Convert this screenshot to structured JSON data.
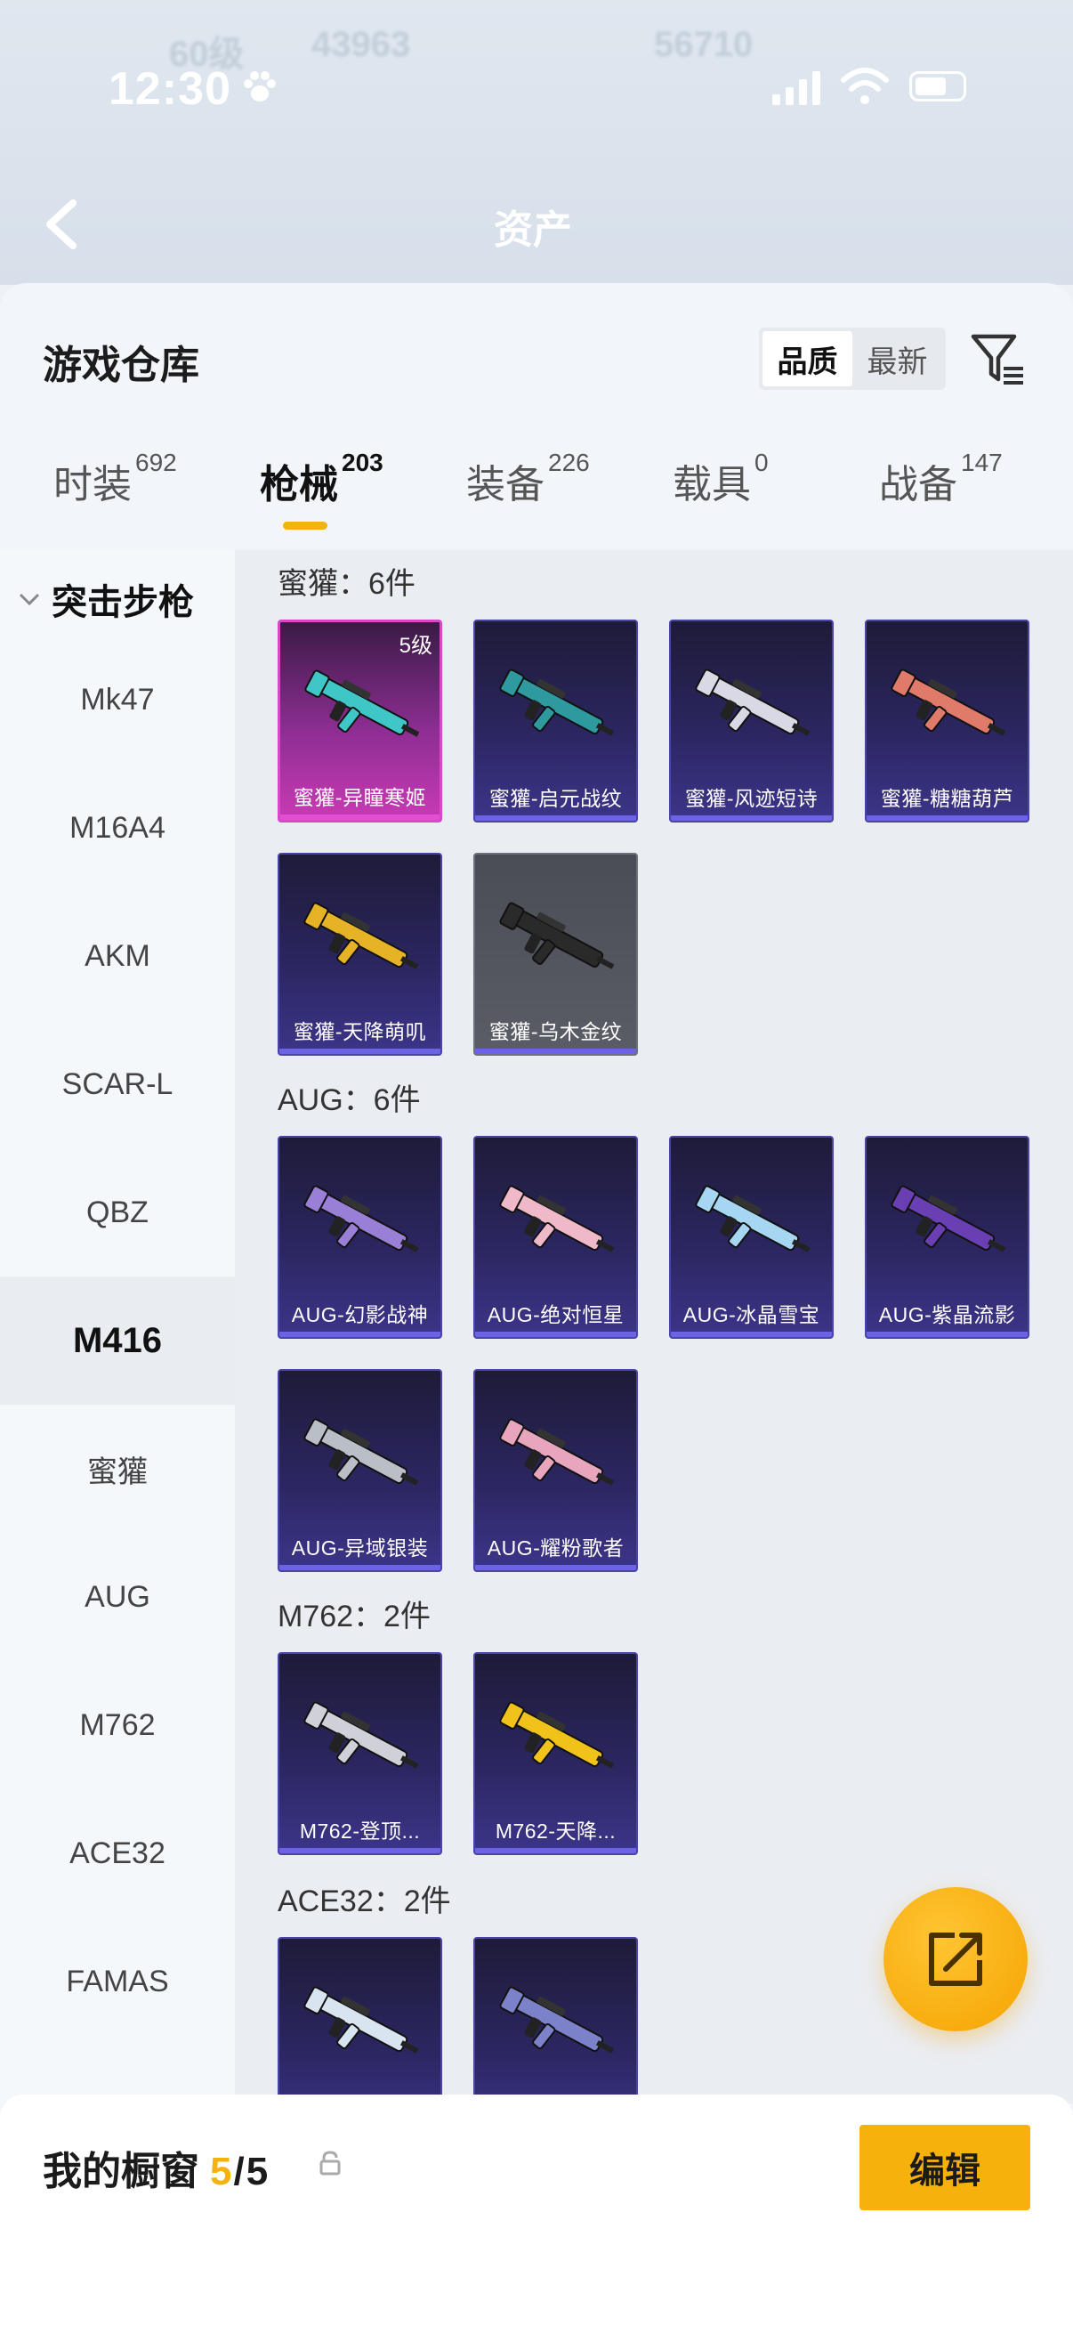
{
  "status": {
    "time": "12:30"
  },
  "header": {
    "title": "资产",
    "ghost_texts": [
      "60级",
      "43963",
      "56710"
    ]
  },
  "sheet": {
    "title": "游戏仓库",
    "sort": {
      "quality": "品质",
      "newest": "最新"
    }
  },
  "tabs": [
    {
      "label": "时装",
      "count": "692"
    },
    {
      "label": "枪械",
      "count": "203"
    },
    {
      "label": "装备",
      "count": "226"
    },
    {
      "label": "载具",
      "count": "0"
    },
    {
      "label": "战备",
      "count": "147"
    }
  ],
  "sidebar": {
    "category": "突击步枪",
    "items": [
      "Mk47",
      "M16A4",
      "AKM",
      "SCAR-L",
      "QBZ",
      "M416",
      "蜜獾",
      "AUG",
      "M762",
      "ACE32",
      "FAMAS"
    ],
    "active": "M416"
  },
  "groups": [
    {
      "title": "蜜獾：6件",
      "items": [
        {
          "name": "蜜獾-异瞳寒姬",
          "level": "5级",
          "style": "pink",
          "color": "#3fc7c7"
        },
        {
          "name": "蜜獾-启元战纹",
          "style": "blue",
          "color": "#2e9aa0"
        },
        {
          "name": "蜜獾-风迹短诗",
          "style": "blue",
          "color": "#d9d9e6"
        },
        {
          "name": "蜜獾-糖糖葫芦",
          "style": "blue",
          "color": "#e07a6a"
        },
        {
          "name": "蜜獾-天降萌叽",
          "style": "blue",
          "color": "#e6b226"
        },
        {
          "name": "蜜獾-乌木金纹",
          "style": "gray",
          "color": "#2a2a2a"
        }
      ]
    },
    {
      "title": "AUG：6件",
      "items": [
        {
          "name": "AUG-幻影战神",
          "style": "blue",
          "color": "#9a7fd6"
        },
        {
          "name": "AUG-绝对恒星",
          "style": "blue",
          "color": "#f0b9c9"
        },
        {
          "name": "AUG-冰晶雪宝",
          "style": "blue",
          "color": "#a7d6f2"
        },
        {
          "name": "AUG-紫晶流影",
          "style": "blue",
          "color": "#6a3fb3"
        },
        {
          "name": "AUG-异域银装",
          "style": "blue",
          "color": "#b9bec7"
        },
        {
          "name": "AUG-耀粉歌者",
          "style": "blue",
          "color": "#e8a6be"
        }
      ]
    },
    {
      "title": "M762：2件",
      "items": [
        {
          "name": "M762-登顶...",
          "style": "blue",
          "color": "#d0d0d8"
        },
        {
          "name": "M762-天降...",
          "style": "blue",
          "color": "#f1c21a"
        }
      ]
    },
    {
      "title": "ACE32：2件",
      "items": [
        {
          "name": "",
          "style": "blue",
          "color": "#d8e4f0"
        },
        {
          "name": "",
          "style": "blue",
          "color": "#7b82c9"
        }
      ]
    }
  ],
  "window": {
    "label": "我的橱窗",
    "current": "5",
    "total": "5",
    "edit": "编辑"
  },
  "colors": {
    "accent": "#f5b20c",
    "card_bg": "#2b2660",
    "card_border": "#4b44a8",
    "highlight_pink": "#d948c8"
  }
}
